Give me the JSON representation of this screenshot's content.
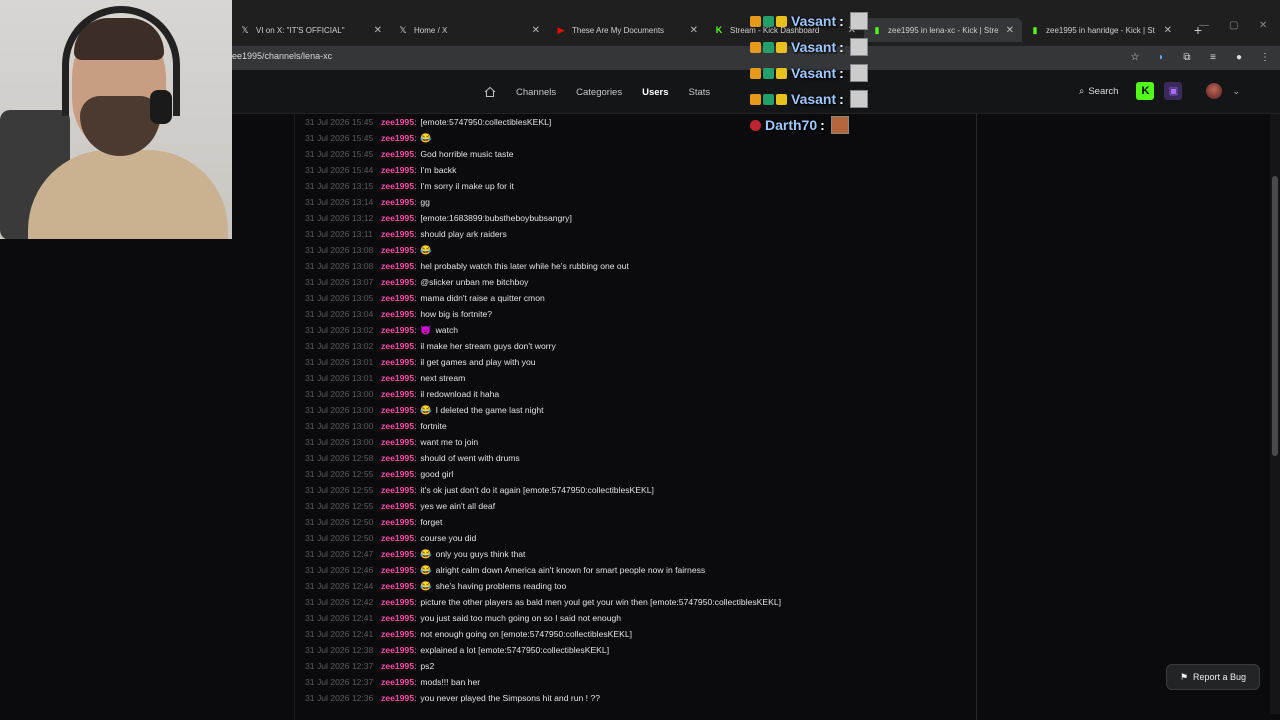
{
  "browser": {
    "tabs": [
      {
        "title": "VI on X: \"IT'S OFFICIAL\"",
        "icon": "x-logo-icon",
        "active": false
      },
      {
        "title": "Home / X",
        "icon": "x-logo-icon",
        "active": false
      },
      {
        "title": "These Are My Documents",
        "icon": "youtube-icon",
        "active": false
      },
      {
        "title": "Stream - Kick Dashboard",
        "icon": "kick-icon",
        "active": false
      },
      {
        "title": "zee1995 in lena-xc - Kick | Stre",
        "icon": "stats-icon",
        "active": true
      },
      {
        "title": "zee1995 in hanridge - Kick | St",
        "icon": "stats-icon",
        "active": false
      }
    ],
    "url": "ee1995/channels/lena-xc"
  },
  "nav": {
    "links": [
      {
        "label": "Channels"
      },
      {
        "label": "Categories"
      },
      {
        "label": "Users",
        "active": true
      },
      {
        "label": "Stats"
      }
    ],
    "search_label": "Search"
  },
  "chat": {
    "username": "zee1995",
    "messages": [
      {
        "ts": "31 Jul 2026 15:45",
        "text": "[emote:5747950:collectiblesKEKL]"
      },
      {
        "ts": "31 Jul 2026 15:45",
        "emoji": "😂",
        "text": ""
      },
      {
        "ts": "31 Jul 2026 15:45",
        "text": "God horrible music taste"
      },
      {
        "ts": "31 Jul 2026 15:44",
        "text": "I'm backk"
      },
      {
        "ts": "31 Jul 2026 13:15",
        "text": "I'm sorry il make up for it"
      },
      {
        "ts": "31 Jul 2026 13:14",
        "text": "gg"
      },
      {
        "ts": "31 Jul 2026 13:12",
        "text": "[emote:1683899:bubstheboybubsangry]"
      },
      {
        "ts": "31 Jul 2026 13:11",
        "text": "should play ark raiders"
      },
      {
        "ts": "31 Jul 2026 13:08",
        "emoji": "😂",
        "text": ""
      },
      {
        "ts": "31 Jul 2026 13:08",
        "text": "hel probably watch this later while he's rubbing one out"
      },
      {
        "ts": "31 Jul 2026 13:07",
        "text": "@slicker unban me bitchboy"
      },
      {
        "ts": "31 Jul 2026 13:05",
        "text": "mama didn't raise a quitter cmon"
      },
      {
        "ts": "31 Jul 2026 13:04",
        "text": "how big is fortnite?"
      },
      {
        "ts": "31 Jul 2026 13:02",
        "emoji": "😈",
        "text": "watch"
      },
      {
        "ts": "31 Jul 2026 13:02",
        "text": "il make her stream guys don't worry"
      },
      {
        "ts": "31 Jul 2026 13:01",
        "text": "il get games and play with you"
      },
      {
        "ts": "31 Jul 2026 13:01",
        "text": "next stream"
      },
      {
        "ts": "31 Jul 2026 13:00",
        "text": "il redownload it haha"
      },
      {
        "ts": "31 Jul 2026 13:00",
        "emoji": "😂",
        "text": "I deleted the game last night"
      },
      {
        "ts": "31 Jul 2026 13:00",
        "text": "fortnite"
      },
      {
        "ts": "31 Jul 2026 13:00",
        "text": "want me to join"
      },
      {
        "ts": "31 Jul 2026 12:58",
        "text": "should of went with drums"
      },
      {
        "ts": "31 Jul 2026 12:55",
        "text": "good girl"
      },
      {
        "ts": "31 Jul 2026 12:55",
        "text": "it's ok just don't do it again [emote:5747950:collectiblesKEKL]"
      },
      {
        "ts": "31 Jul 2026 12:55",
        "text": "yes we ain't all deaf"
      },
      {
        "ts": "31 Jul 2026 12:50",
        "text": "forget"
      },
      {
        "ts": "31 Jul 2026 12:50",
        "text": "course you did"
      },
      {
        "ts": "31 Jul 2026 12:47",
        "emoji": "😂",
        "text": "only you guys think that"
      },
      {
        "ts": "31 Jul 2026 12:46",
        "emoji": "😂",
        "text": "alright calm down America ain't known for smart people now in fairness"
      },
      {
        "ts": "31 Jul 2026 12:44",
        "emoji": "😂",
        "text": "she's having problems reading too"
      },
      {
        "ts": "31 Jul 2026 12:42",
        "text": "picture the other players as bald men youl get your win then [emote:5747950:collectiblesKEKL]"
      },
      {
        "ts": "31 Jul 2026 12:41",
        "text": "you just said too much going on so I said not enough"
      },
      {
        "ts": "31 Jul 2026 12:41",
        "text": "not enough going on [emote:5747950:collectiblesKEKL]"
      },
      {
        "ts": "31 Jul 2026 12:38",
        "text": "explained a lot [emote:5747950:collectiblesKEKL]"
      },
      {
        "ts": "31 Jul 2026 12:37",
        "text": "ps2"
      },
      {
        "ts": "31 Jul 2026 12:37",
        "text": "mods!!! ban her"
      },
      {
        "ts": "31 Jul 2026 12:36",
        "text": "you never played the Simpsons hit and run ! ??"
      }
    ]
  },
  "report_bug": {
    "label": "Report a Bug"
  },
  "overlay": {
    "messages": [
      {
        "name": "Vasant",
        "colon": ":"
      },
      {
        "name": "Vasant",
        "colon": ":"
      },
      {
        "name": "Vasant",
        "colon": ":"
      },
      {
        "name": "Vasant",
        "colon": ":"
      },
      {
        "name": "Darth70",
        "colon": ":"
      }
    ]
  },
  "colors": {
    "username": "#ff4fa8",
    "kick_green": "#53fc18",
    "overlay_name": "#9ec8ff"
  }
}
